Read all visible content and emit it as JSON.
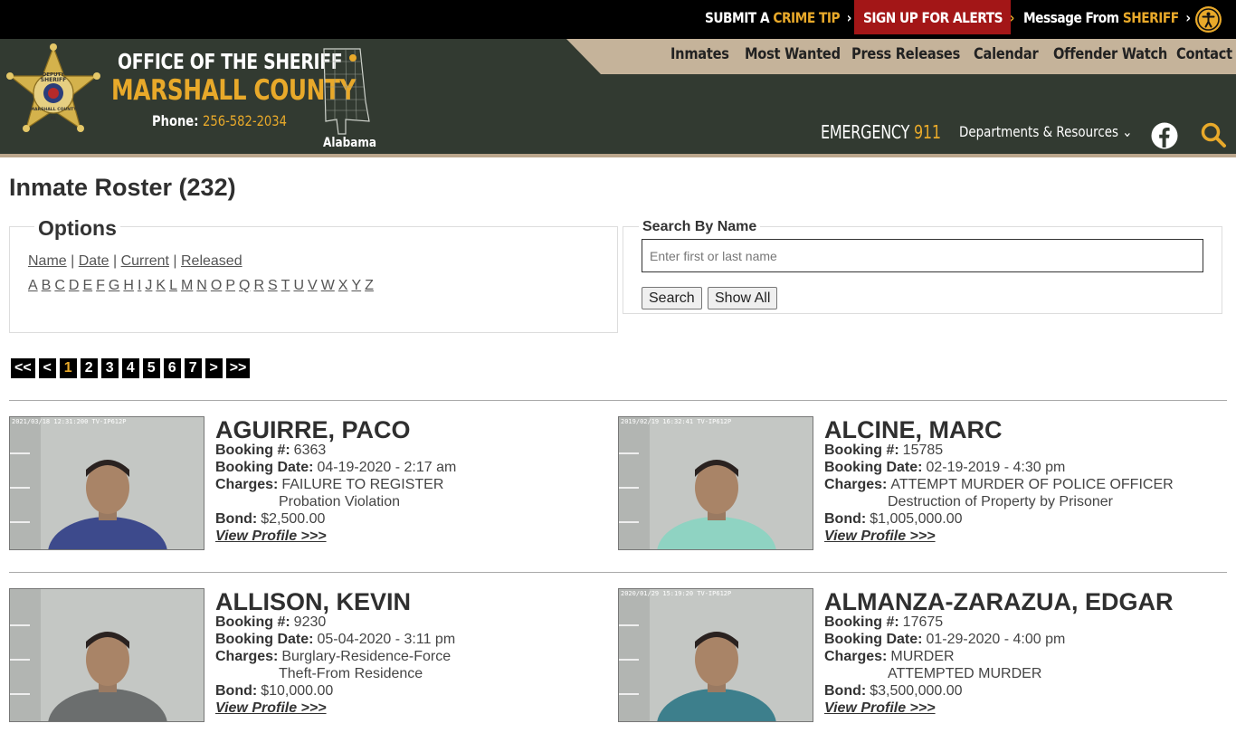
{
  "topbar": {
    "tip_a": "SUBMIT A",
    "tip_b": "CRIME TIP",
    "alerts": "SIGN UP FOR ALERTS",
    "msg_a": "Message From",
    "msg_b": "SHERIFF",
    "chevron": "›"
  },
  "header": {
    "brand_line1": "OFFICE OF THE SHERIFF",
    "brand_line2": "MARSHALL COUNTY",
    "phone_label": "Phone:",
    "phone_number": "256-582-2034",
    "state_label": "Alabama",
    "emergency_a": "EMERGENCY",
    "emergency_b": "911",
    "departments": "Departments & Resources ⌄",
    "nav": [
      "Inmates",
      "Most Wanted",
      "Press Releases",
      "Calendar",
      "Offender Watch",
      "Contact"
    ],
    "star_text": {
      "top": "DEPUTY",
      "middle": "SHERIFF",
      "lower": "MARSHALL COUNTY",
      "bottom": "AL"
    },
    "colors": {
      "header_bg": "#323a31",
      "accent": "#e8a92a",
      "alert": "#a31617",
      "tab": "#c5b39a"
    }
  },
  "roster": {
    "title": "Inmate Roster (232)",
    "options_legend": "Options",
    "sort_links": [
      "Name",
      "Date",
      "Current",
      "Released"
    ],
    "letters": [
      "A",
      "B",
      "C",
      "D",
      "E",
      "F",
      "G",
      "H",
      "I",
      "J",
      "K",
      "L",
      "M",
      "N",
      "O",
      "P",
      "Q",
      "R",
      "S",
      "T",
      "U",
      "V",
      "W",
      "X",
      "Y",
      "Z"
    ],
    "search_legend": "Search By Name",
    "search_placeholder": "Enter first or last name",
    "search_button": "Search",
    "showall_button": "Show All",
    "pager": [
      "<<",
      "<",
      "1",
      "2",
      "3",
      "4",
      "5",
      "6",
      "7",
      ">",
      ">>"
    ],
    "current_page": "1"
  },
  "labels": {
    "booking_no": "Booking #:",
    "booking_date": "Booking Date:",
    "charges": "Charges:",
    "bond": "Bond:",
    "view_profile": "View Profile >>>"
  },
  "inmates": [
    {
      "name": "AGUIRRE, PACO",
      "booking_no": "6363",
      "booking_date": "04-19-2020 - 2:17 am",
      "charges": [
        "FAILURE TO REGISTER",
        "Probation Violation"
      ],
      "bond": "$2,500.00",
      "photo_stamp": "2021/03/18 12:31:200 TV-IP612P",
      "shirt": "#3d4a8c"
    },
    {
      "name": "ALCINE, MARC",
      "booking_no": "15785",
      "booking_date": "02-19-2019 - 4:30 pm",
      "charges": [
        "ATTEMPT MURDER OF POLICE OFFICER",
        "Destruction of Property by Prisoner"
      ],
      "bond": "$1,005,000.00",
      "photo_stamp": "2019/02/19 16:32:41 TV-IP612P",
      "shirt": "#8fd3c2"
    },
    {
      "name": "ALLISON, KEVIN",
      "booking_no": "9230",
      "booking_date": "05-04-2020 - 3:11 pm",
      "charges": [
        "Burglary-Residence-Force",
        "Theft-From Residence"
      ],
      "bond": "$10,000.00",
      "photo_stamp": "",
      "shirt": "#6b6e6e"
    },
    {
      "name": "ALMANZA-ZARAZUA, EDGAR",
      "booking_no": "17675",
      "booking_date": "01-29-2020 - 4:00 pm",
      "charges": [
        "MURDER",
        "ATTEMPTED MURDER"
      ],
      "bond": "$3,500,000.00",
      "photo_stamp": "2020/01/29 15:19:20 TV-IP612P",
      "shirt": "#3d7f8c"
    }
  ]
}
